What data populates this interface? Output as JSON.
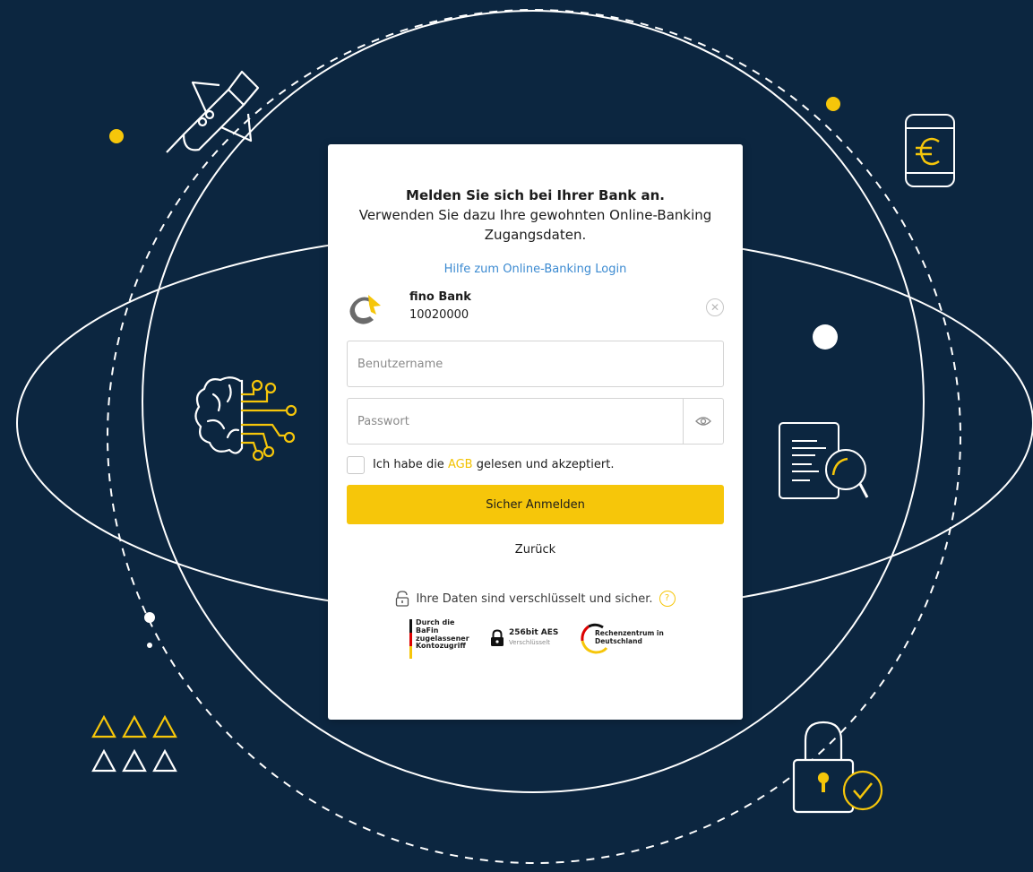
{
  "heading": {
    "line1": "Melden Sie sich bei Ihrer Bank an.",
    "line2": "Verwenden Sie dazu Ihre gewohnten Online-Banking Zugangsdaten."
  },
  "help_link": "Hilfe zum Online-Banking Login",
  "bank": {
    "name": "fino Bank",
    "code": "10020000"
  },
  "username": {
    "placeholder": "Benutzername",
    "value": ""
  },
  "password": {
    "placeholder": "Passwort",
    "value": ""
  },
  "terms": {
    "prefix": "Ich habe die ",
    "link": "AGB",
    "suffix": " gelesen und akzeptiert.",
    "checked": false
  },
  "submit_label": "Sicher Anmelden",
  "back_label": "Zurück",
  "security_note": "Ihre Daten sind verschlüsselt und sicher.",
  "badges": {
    "bafin": [
      "Durch die",
      "BaFin",
      "zugelassener",
      "Kontozugriff"
    ],
    "aes_title": "256bit AES",
    "aes_sub": "Verschlüsselt",
    "datacenter": "Rechenzentrum in Deutschland"
  },
  "colors": {
    "background": "#0c2640",
    "accent": "#f6c60a",
    "link": "#3b8ad1",
    "card": "#ffffff"
  },
  "icons": [
    "rocket-icon",
    "euro-phone-icon",
    "brain-circuit-icon",
    "document-search-icon",
    "padlock-check-icon",
    "triangles-icon",
    "clear-icon",
    "eye-icon",
    "lock-icon",
    "question-icon"
  ]
}
